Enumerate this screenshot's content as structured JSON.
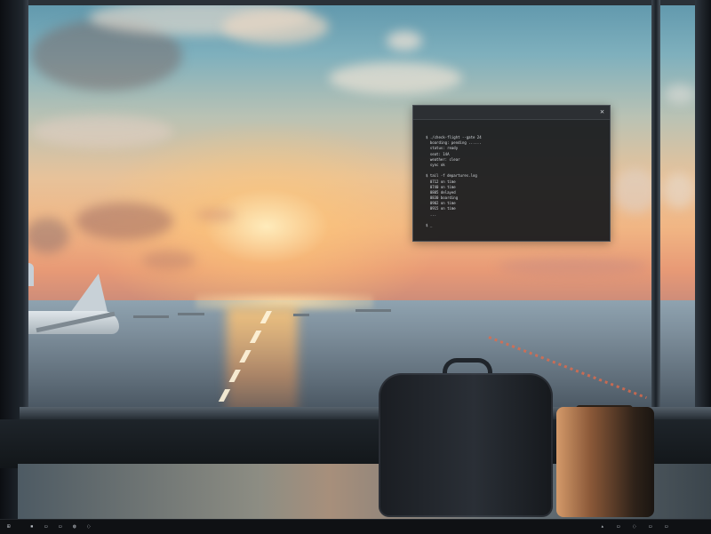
{
  "window": {
    "title": "",
    "close_glyph": "✕",
    "lines": [
      "$ ./check-flight --gate 24",
      "  boarding: pending ......",
      "  status: ready",
      "  seat: 14A",
      "  weather: clear",
      "  sync ok",
      "",
      "$ tail -f departures.log",
      "  0712 on time",
      "  0740 on time",
      "  0805 delayed",
      "  0830 boarding",
      "  0902 on time",
      "  0915 on time",
      "  ...",
      "",
      "$ _"
    ]
  },
  "taskbar": {
    "start_glyph": "⊞",
    "left_items": [
      "▪",
      "▭",
      "▭",
      "◍",
      "◌"
    ],
    "tray_items": [
      "▴",
      "▭",
      "◌",
      "▭",
      "▭"
    ]
  },
  "colors": {
    "terminal_bg": "#181a1d",
    "terminal_text": "#d6dade",
    "taskbar_bg": "#0f1114"
  }
}
